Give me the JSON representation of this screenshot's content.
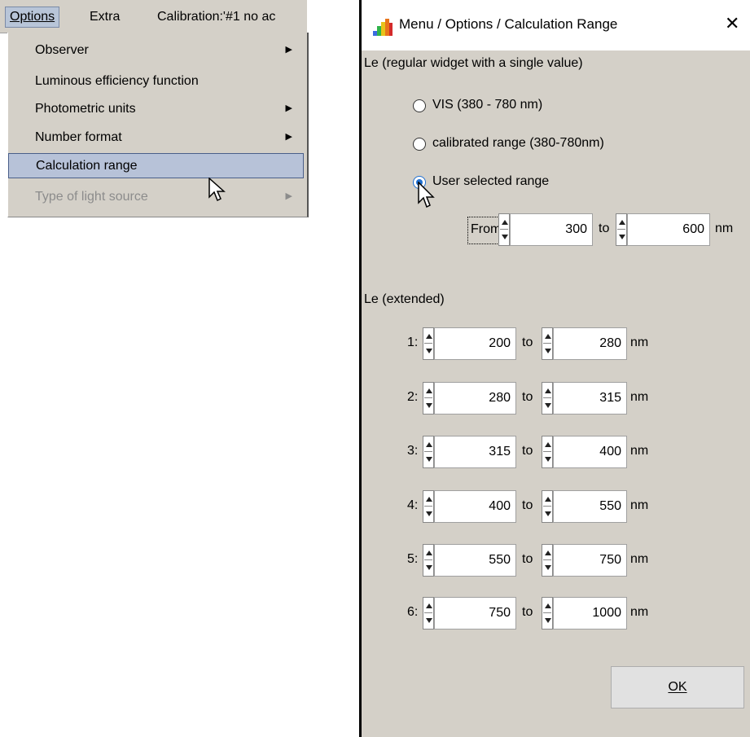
{
  "menubar": {
    "options": "Options",
    "extra": "Extra",
    "calibration": "Calibration:'#1  no ac"
  },
  "menu": {
    "items": [
      {
        "label": "Observer",
        "submenu": true
      },
      {
        "label": "Luminous efficiency function",
        "submenu": false
      },
      {
        "label": "Photometric units",
        "submenu": true
      },
      {
        "label": "Number format",
        "submenu": true
      },
      {
        "label": "Calculation range",
        "submenu": false,
        "selected": true
      },
      {
        "label": "Type of light source",
        "submenu": true,
        "disabled": true
      }
    ]
  },
  "dialog": {
    "title": "Menu / Options / Calculation Range",
    "close_icon": "close-icon",
    "section1_label": "Le (regular widget with a single value)",
    "radio_vis": "VIS (380 - 780 nm)",
    "radio_calibrated": "calibrated range (380-780nm)",
    "radio_user": "User selected range",
    "selected_radio": "user",
    "from_label": "From",
    "from_value": "300",
    "to_label": "to",
    "to_value": "600",
    "unit": "nm",
    "section2_label": "Le (extended)",
    "ranges": [
      {
        "index": "1:",
        "from": "200",
        "to": "280"
      },
      {
        "index": "2:",
        "from": "280",
        "to": "315"
      },
      {
        "index": "3:",
        "from": "315",
        "to": "400"
      },
      {
        "index": "4:",
        "from": "400",
        "to": "550"
      },
      {
        "index": "5:",
        "from": "550",
        "to": "750"
      },
      {
        "index": "6:",
        "from": "750",
        "to": "1000"
      }
    ],
    "ok_label": "OK"
  },
  "colors": {
    "accent": "#1f6fd1",
    "menu_highlight": "#b7c2d8",
    "window_bg": "#d4d0c8"
  }
}
